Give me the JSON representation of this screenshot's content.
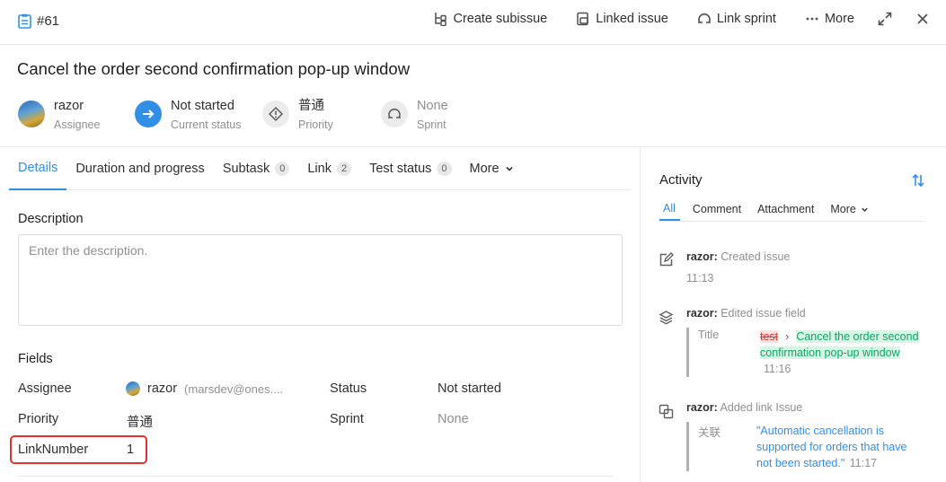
{
  "header": {
    "issue_number": "#61",
    "actions": {
      "create_subissue": "Create subissue",
      "linked_issue": "Linked issue",
      "link_sprint": "Link sprint",
      "more": "More"
    }
  },
  "issue": {
    "title": "Cancel the order second confirmation pop-up window"
  },
  "summary": {
    "assignee": {
      "value": "razor",
      "label": "Assignee"
    },
    "status": {
      "value": "Not started",
      "label": "Current status",
      "color": "#338fe5"
    },
    "priority": {
      "value": "普通",
      "label": "Priority"
    },
    "sprint": {
      "value": "None",
      "label": "Sprint"
    }
  },
  "tabs": [
    {
      "label": "Details"
    },
    {
      "label": "Duration and progress"
    },
    {
      "label": "Subtask",
      "count": "0"
    },
    {
      "label": "Link",
      "count": "2"
    },
    {
      "label": "Test status",
      "count": "0"
    },
    {
      "label": "More"
    }
  ],
  "description": {
    "heading": "Description",
    "placeholder": "Enter the description."
  },
  "fields": {
    "heading": "Fields",
    "assignee_label": "Assignee",
    "assignee_name": "razor",
    "assignee_email": "(marsdev@ones....",
    "status_label": "Status",
    "status_value": "Not started",
    "priority_label": "Priority",
    "priority_value": "普通",
    "sprint_label": "Sprint",
    "sprint_value": "None",
    "link_number_label": "LinkNumber",
    "link_number_value": "1"
  },
  "activity": {
    "title": "Activity",
    "tabs": [
      "All",
      "Comment",
      "Attachment",
      "More"
    ],
    "items": [
      {
        "user": "razor:",
        "action": "Created issue",
        "time": "11:13"
      },
      {
        "user": "razor:",
        "action": "Edited issue field",
        "key": "Title",
        "old": "test",
        "new": "Cancel the order second confirmation pop-up window",
        "time": "11:16"
      },
      {
        "user": "razor:",
        "action": "Added link Issue",
        "key": "关联",
        "value": "\"Automatic cancellation is supported for orders that have not been started.\"",
        "time": "11:17"
      }
    ]
  },
  "colors": {
    "accent": "#338fe5",
    "highlight": "#e53030"
  }
}
